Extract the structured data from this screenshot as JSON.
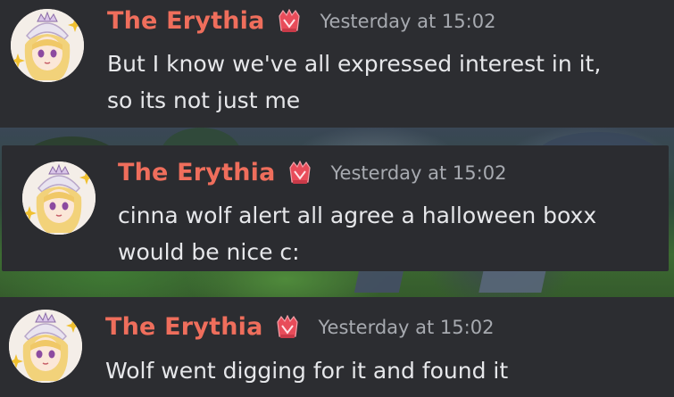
{
  "chat": {
    "messages": [
      {
        "username": "The Erythia",
        "timestamp": "Yesterday at 15:02",
        "text": "But I know we've all expressed interest in it,\nso its not just me",
        "avatar": "anime-avatar-icon",
        "role_icon": "boost-badge-icon"
      },
      {
        "username": "The Erythia",
        "timestamp": "Yesterday at 15:02",
        "text": "cinna wolf alert all agree a halloween boxx\nwould be nice c:",
        "avatar": "anime-avatar-icon",
        "role_icon": "boost-badge-icon"
      },
      {
        "username": "The Erythia",
        "timestamp": "Yesterday at 15:02",
        "text": "Wolf went digging for it and found it",
        "avatar": "anime-avatar-icon",
        "role_icon": "boost-badge-icon"
      }
    ]
  },
  "colors": {
    "background": "#2c2d31",
    "username": "#ef6e5c",
    "timestamp": "#a7aab0",
    "message_text": "#e6e7ea",
    "badge": "#e84c5a"
  }
}
